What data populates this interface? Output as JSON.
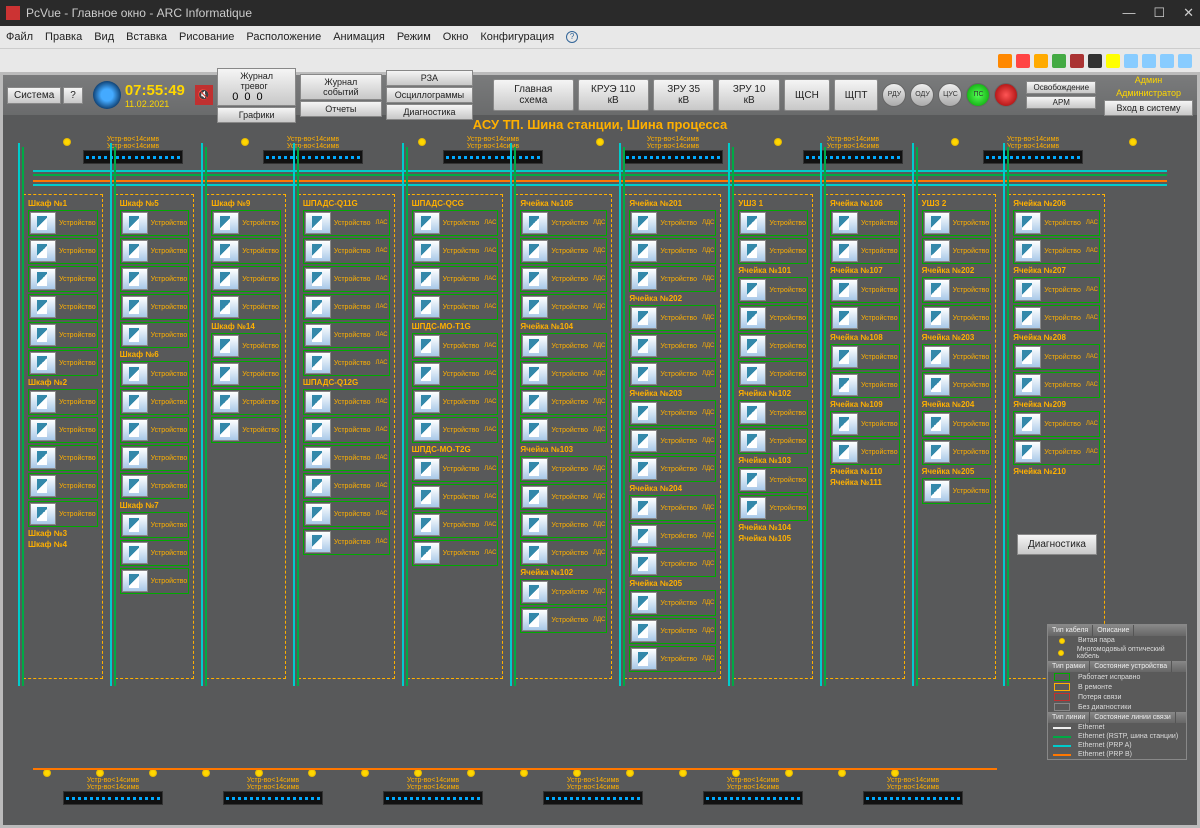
{
  "window": {
    "title": "PcVue - Главное окно - ARC Informatique"
  },
  "menu": [
    "Файл",
    "Правка",
    "Вид",
    "Вставка",
    "Рисование",
    "Расположение",
    "Анимация",
    "Режим",
    "Окно",
    "Конфигурация"
  ],
  "topbar": {
    "system": "Система",
    "help": "?",
    "time": "07:55:49",
    "date": "11.02.2021",
    "alarm_journal": "Журнал тревог",
    "event_journal": "Журнал событий",
    "rza": "РЗА",
    "oscillo": "Осциллограммы",
    "graphs": "Графики",
    "reports": "Отчеты",
    "diag": "Диагностика",
    "counts": [
      "0",
      "0",
      "0"
    ],
    "nav": [
      "Главная схема",
      "КРУЭ 110 кВ",
      "ЗРУ 35 кВ",
      "ЗРУ 10 кВ",
      "ЩСН",
      "ЩПТ"
    ],
    "rdu": [
      "РДУ",
      "ОДУ",
      "ЦУС",
      "ПС",
      ""
    ],
    "release": "Освобождение",
    "arm": "АРМ",
    "admin": "Админ",
    "administrator": "Администратор",
    "login": "Вход в систему"
  },
  "title_hdr": "АСУ ТП. Шина станции, Шина процесса",
  "switch_lbl1": "Устр-во<14симв",
  "switch_lbl2": "Устр-во<14симв",
  "dev_lbl": "Устройство",
  "columns": [
    {
      "titles": [
        "Шкаф №1",
        "Шкаф №2",
        "Шкаф №3",
        "Шкаф №4"
      ],
      "groups": [
        2,
        2,
        2,
        2,
        2,
        1
      ]
    },
    {
      "titles": [
        "Шкаф №5",
        "Шкаф №6",
        "Шкаф №7"
      ],
      "groups": [
        2,
        2,
        1,
        2,
        1,
        2,
        1,
        2
      ]
    },
    {
      "titles": [
        "Шкаф №9",
        "Шкаф №14"
      ],
      "groups": [
        2,
        2,
        1,
        1,
        2
      ]
    },
    {
      "titles": [
        "ШПАДС-Q11G",
        "ШПАДС-Q12G"
      ],
      "groups": [
        1,
        1,
        1,
        1,
        1,
        1,
        1,
        1,
        1,
        1,
        1,
        1
      ],
      "sidelbl": "ЛАС"
    },
    {
      "titles": [
        "ШПАДС-QCG",
        "ШПДС-МО-Т1G",
        "ШПДС-МО-Т2G"
      ],
      "groups": [
        1,
        1,
        1,
        1,
        1,
        1,
        1,
        1,
        1,
        1,
        1,
        1
      ],
      "sidelbl": "ЛАС"
    },
    {
      "titles": [
        "Ячейка №105",
        "Ячейка №104",
        "Ячейка №103",
        "Ячейка №102"
      ],
      "groups": [
        2,
        2,
        2,
        2,
        2,
        2,
        2
      ],
      "sidelbl": "ЛДС"
    },
    {
      "titles": [
        "Ячейка №201",
        "Ячейка №202",
        "Ячейка №203",
        "Ячейка №204",
        "Ячейка №205"
      ],
      "groups": [
        2,
        1,
        2,
        1,
        2,
        1,
        2,
        1,
        2,
        1
      ],
      "sidelbl": "ЛДС"
    },
    {
      "titles": [
        "УШЗ 1",
        "Ячейка №101",
        "Ячейка №102",
        "Ячейка №103",
        "Ячейка №104",
        "Ячейка №105"
      ],
      "groups": [
        2,
        1,
        2,
        1,
        1,
        1,
        1,
        1
      ]
    },
    {
      "titles": [
        "Ячейка №106",
        "Ячейка №107",
        "Ячейка №108",
        "Ячейка №109",
        "Ячейка №110",
        "Ячейка №111"
      ],
      "groups": [
        1,
        1,
        1,
        1,
        1,
        1,
        1,
        1
      ]
    },
    {
      "titles": [
        "УШЗ 2",
        "Ячейка №202",
        "Ячейка №203",
        "Ячейка №204",
        "Ячейка №205"
      ],
      "groups": [
        2,
        1,
        1,
        1,
        1,
        1,
        1,
        1
      ]
    },
    {
      "titles": [
        "Ячейка №206",
        "Ячейка №207",
        "Ячейка №208",
        "Ячейка №209",
        "Ячейка №210"
      ],
      "groups": [
        2,
        1,
        1,
        1,
        1,
        1,
        1
      ],
      "sidelbl": "ЛАС"
    }
  ],
  "diag_btn": "Диагностика",
  "legend": {
    "h1": "Тип кабеля",
    "h2": "Описание",
    "cable": [
      "Витая пара",
      "Многомодовый оптический кабель"
    ],
    "h3": "Тип рамки",
    "h4": "Состояние устройства",
    "frame": [
      "Работает исправно",
      "В ремонте",
      "Потеря связи",
      "Без диагностики"
    ],
    "frame_colors": [
      "#0a0",
      "#ffb000",
      "#c03030",
      "#888"
    ],
    "h5": "Тип линии",
    "h6": "Состояние линии связи",
    "line": [
      "Ethernet",
      "Ethernet (RSTP, шина станции)",
      "Ethernet (PRP A)",
      "Ethernet (PRP B)"
    ],
    "line_colors": [
      "#eee",
      "#00aa44",
      "#00cccc",
      "#ff7700"
    ]
  }
}
